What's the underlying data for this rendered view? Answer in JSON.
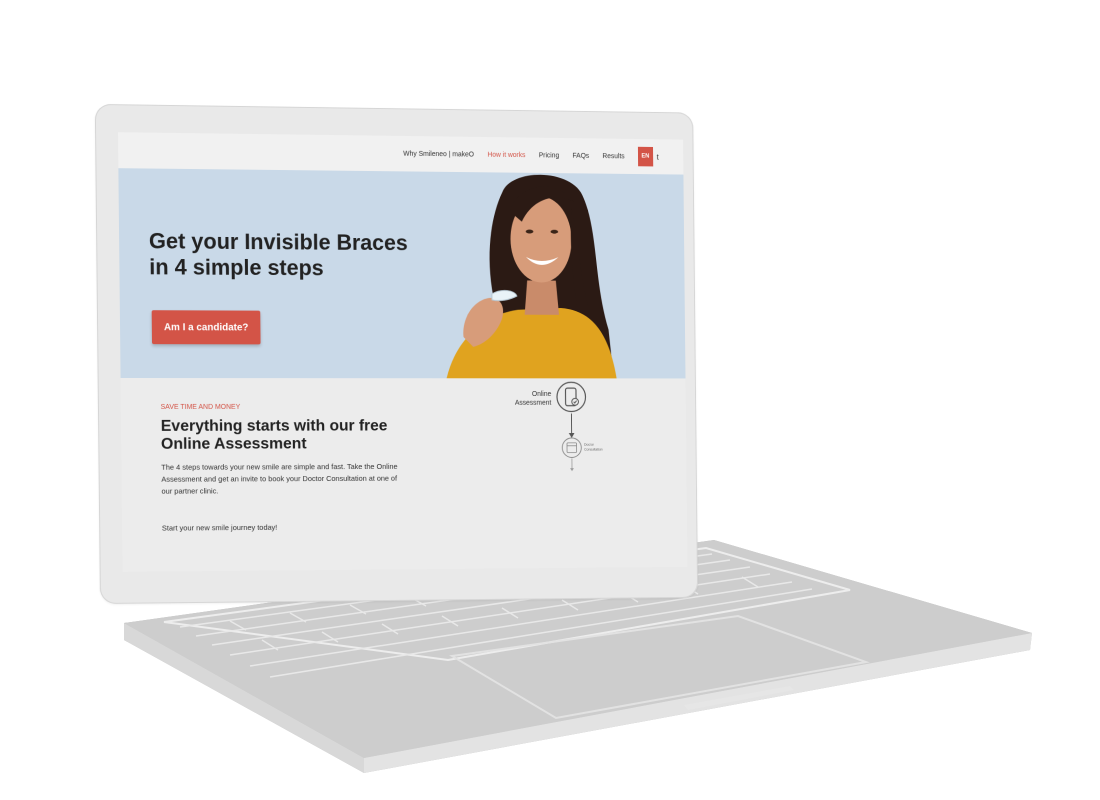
{
  "nav": {
    "items": [
      "Why Smileneo | makeO",
      "How it works",
      "Pricing",
      "FAQs",
      "Results"
    ],
    "active_index": 1,
    "lang": "EN",
    "lang_next": "t"
  },
  "hero": {
    "title_line1": "Get your Invisible Braces",
    "title_line2": "in 4 simple steps",
    "cta_label": "Am I a candidate?"
  },
  "section": {
    "eyebrow": "SAVE TIME AND MONEY",
    "title": "Everything starts with our free Online Assessment",
    "body": "The 4 steps towards your new smile are simple and fast. Take the Online Assessment and get an invite to book your Doctor Consultation at one of our partner clinic.",
    "cta_text": "Start your new smile journey today!"
  },
  "steps": [
    {
      "label_line1": "Online",
      "label_line2": "Assessment",
      "icon": "phone-check-icon"
    },
    {
      "label_line1": "Doctor",
      "label_line2": "Consultation",
      "icon": "calendar-icon"
    }
  ],
  "colors": {
    "accent": "#d35447",
    "hero_bg": "#c9d9e8",
    "laptop_body": "#c9c9c9",
    "lid": "#e9e9e9"
  }
}
